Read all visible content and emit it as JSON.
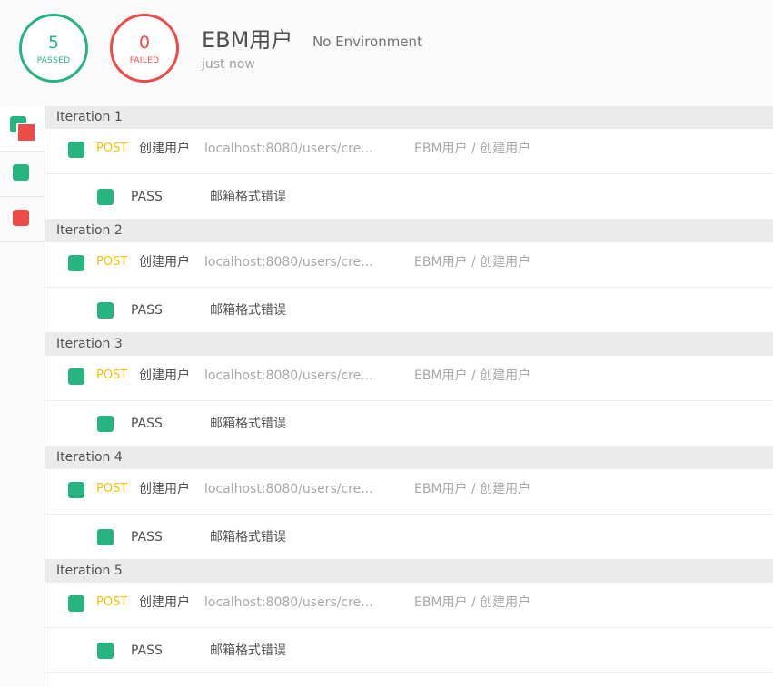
{
  "summary": {
    "passed_count": "5",
    "passed_label": "PASSED",
    "failed_count": "0",
    "failed_label": "FAILED",
    "collection_name": "EBM用户",
    "environment": "No Environment",
    "time": "just now"
  },
  "colors": {
    "pass_green": "#26b47f",
    "fail_red": "#ed4b48",
    "post_method": "#f4c000"
  },
  "filters": [
    {
      "icon": "all-results-icon"
    },
    {
      "icon": "passed-filter-icon"
    },
    {
      "icon": "failed-filter-icon"
    }
  ],
  "iterations": [
    {
      "label": "Iteration 1",
      "request": {
        "method": "POST",
        "name": "创建用户",
        "url": "localhost:8080/users/cre...",
        "path": "EBM用户 / 创建用户"
      },
      "test": {
        "status": "PASS",
        "name": "邮箱格式错误"
      }
    },
    {
      "label": "Iteration 2",
      "request": {
        "method": "POST",
        "name": "创建用户",
        "url": "localhost:8080/users/cre...",
        "path": "EBM用户 / 创建用户"
      },
      "test": {
        "status": "PASS",
        "name": "邮箱格式错误"
      }
    },
    {
      "label": "Iteration 3",
      "request": {
        "method": "POST",
        "name": "创建用户",
        "url": "localhost:8080/users/cre...",
        "path": "EBM用户 / 创建用户"
      },
      "test": {
        "status": "PASS",
        "name": "邮箱格式错误"
      }
    },
    {
      "label": "Iteration 4",
      "request": {
        "method": "POST",
        "name": "创建用户",
        "url": "localhost:8080/users/cre...",
        "path": "EBM用户 / 创建用户"
      },
      "test": {
        "status": "PASS",
        "name": "邮箱格式错误"
      }
    },
    {
      "label": "Iteration 5",
      "request": {
        "method": "POST",
        "name": "创建用户",
        "url": "localhost:8080/users/cre...",
        "path": "EBM用户 / 创建用户"
      },
      "test": {
        "status": "PASS",
        "name": "邮箱格式错误"
      }
    }
  ]
}
